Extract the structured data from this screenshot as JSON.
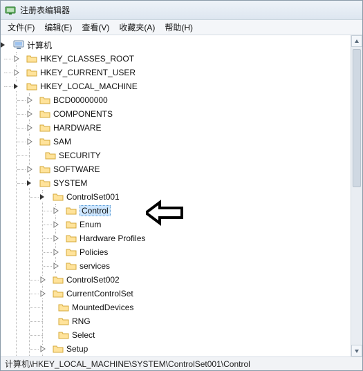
{
  "window": {
    "title": "注册表编辑器"
  },
  "menu": {
    "file": "文件(F)",
    "edit": "编辑(E)",
    "view": "查看(V)",
    "favorites": "收藏夹(A)",
    "help": "帮助(H)"
  },
  "tree": {
    "root": "计算机",
    "hkcr": "HKEY_CLASSES_ROOT",
    "hkcu": "HKEY_CURRENT_USER",
    "hklm": "HKEY_LOCAL_MACHINE",
    "hklm_children": {
      "bcd": "BCD00000000",
      "components": "COMPONENTS",
      "hardware": "HARDWARE",
      "sam": "SAM",
      "security": "SECURITY",
      "software": "SOFTWARE",
      "system": "SYSTEM"
    },
    "system_children": {
      "cs001": "ControlSet001",
      "cs002": "ControlSet002",
      "ccs": "CurrentControlSet",
      "mounted": "MountedDevices",
      "rng": "RNG",
      "select": "Select",
      "setup": "Setup"
    },
    "cs001_children": {
      "control": "Control",
      "enum": "Enum",
      "hwprofiles": "Hardware Profiles",
      "policies": "Policies",
      "services": "services"
    }
  },
  "statusbar": {
    "path": "计算机\\HKEY_LOCAL_MACHINE\\SYSTEM\\ControlSet001\\Control"
  }
}
